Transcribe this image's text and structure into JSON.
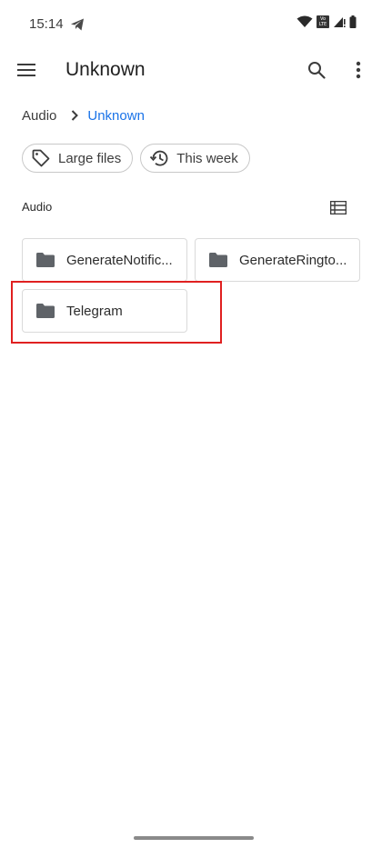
{
  "status_bar": {
    "time": "15:14",
    "volte": "Vo LTE"
  },
  "app_bar": {
    "title": "Unknown"
  },
  "breadcrumb": {
    "root": "Audio",
    "current": "Unknown"
  },
  "chips": [
    {
      "label": "Large files",
      "icon": "tag-icon"
    },
    {
      "label": "This week",
      "icon": "history-icon"
    }
  ],
  "section": {
    "label": "Audio"
  },
  "folders": [
    {
      "name": "GenerateNotific...",
      "icon": "folder-icon"
    },
    {
      "name": "GenerateRingto...",
      "icon": "folder-icon"
    },
    {
      "name": "Telegram",
      "icon": "folder-icon",
      "highlighted": true
    }
  ],
  "colors": {
    "accent": "#1a73e8",
    "highlight": "#e02020",
    "icon": "#5f6368"
  }
}
